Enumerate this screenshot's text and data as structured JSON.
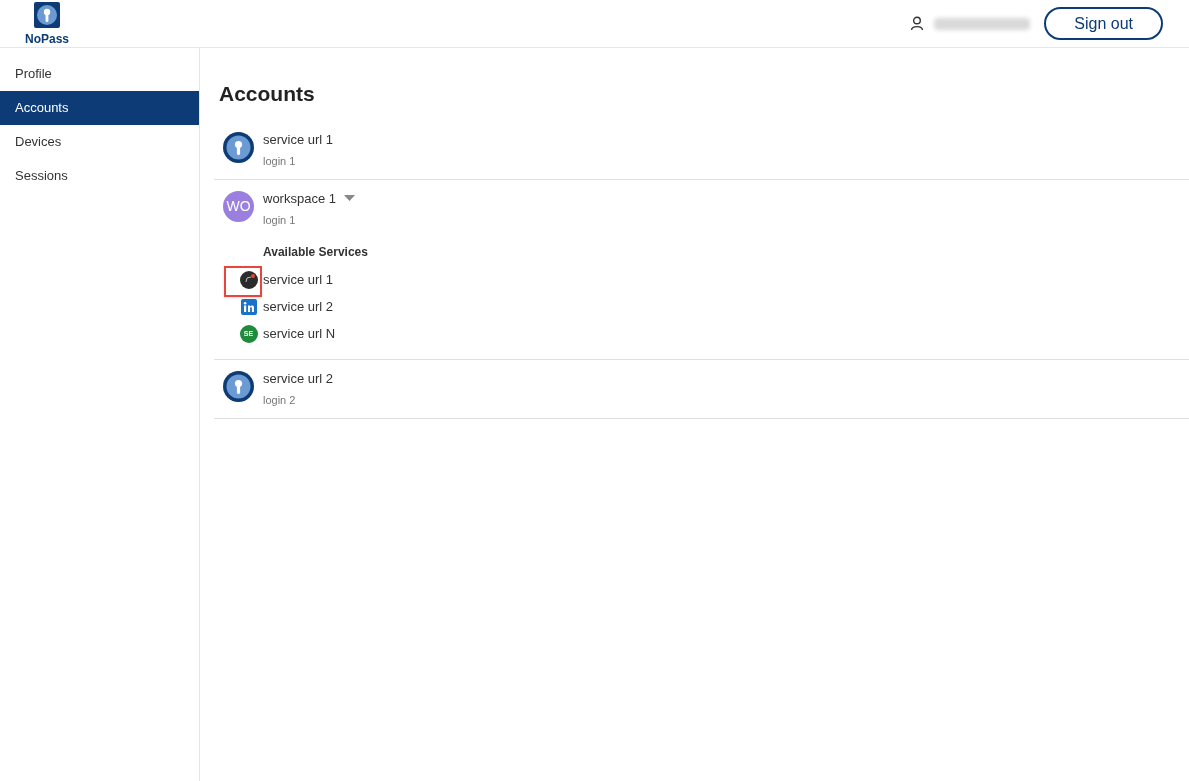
{
  "header": {
    "logo_text": "NoPass",
    "sign_out": "Sign out"
  },
  "sidebar": {
    "items": [
      {
        "label": "Profile",
        "selected": false
      },
      {
        "label": "Accounts",
        "selected": true
      },
      {
        "label": "Devices",
        "selected": false
      },
      {
        "label": "Sessions",
        "selected": false
      }
    ]
  },
  "page_title": "Accounts",
  "accounts": [
    {
      "kind": "key",
      "name": "service url 1",
      "login": "login 1"
    },
    {
      "kind": "workspace",
      "initials": "WO",
      "name": "workspace 1",
      "login": "login 1",
      "expanded": true,
      "services_heading": "Available Services",
      "services": [
        {
          "kind": "dot",
          "name": "service url 1",
          "highlighted": true
        },
        {
          "kind": "in",
          "name": "service url 2",
          "highlighted": false
        },
        {
          "kind": "initials",
          "initials": "SE",
          "name": "service url N",
          "highlighted": false
        }
      ]
    },
    {
      "kind": "key",
      "name": "service url 2",
      "login": "login 2"
    }
  ]
}
